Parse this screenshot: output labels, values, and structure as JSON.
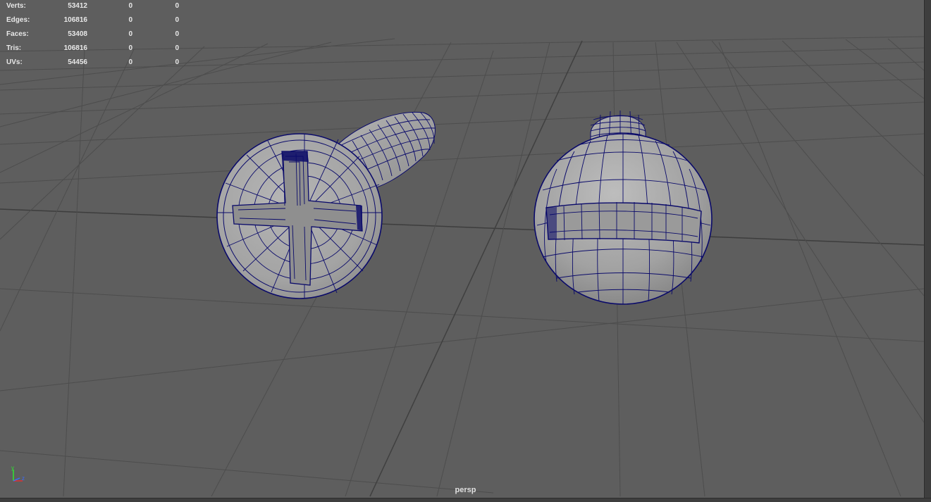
{
  "hud": {
    "rows": [
      {
        "label": "Verts:",
        "v1": "53412",
        "v2": "0",
        "v3": "0"
      },
      {
        "label": "Edges:",
        "v1": "106816",
        "v2": "0",
        "v3": "0"
      },
      {
        "label": "Faces:",
        "v1": "53408",
        "v2": "0",
        "v3": "0"
      },
      {
        "label": "Tris:",
        "v1": "106816",
        "v2": "0",
        "v3": "0"
      },
      {
        "label": "UVs:",
        "v1": "54456",
        "v2": "0",
        "v3": "0"
      }
    ]
  },
  "camera": "persp",
  "axis": {
    "y": "y",
    "z": "z"
  },
  "colors": {
    "background": "#5e5e5e",
    "grid": "#4a4a4a",
    "wire": "#0a0a6a",
    "mesh": "#a5a5a5",
    "axis_y": "#2ee62e",
    "axis_x": "#e03030",
    "axis_z": "#3a6bff"
  },
  "objects": [
    {
      "name": "phillips-screw"
    },
    {
      "name": "slotted-screw"
    }
  ]
}
